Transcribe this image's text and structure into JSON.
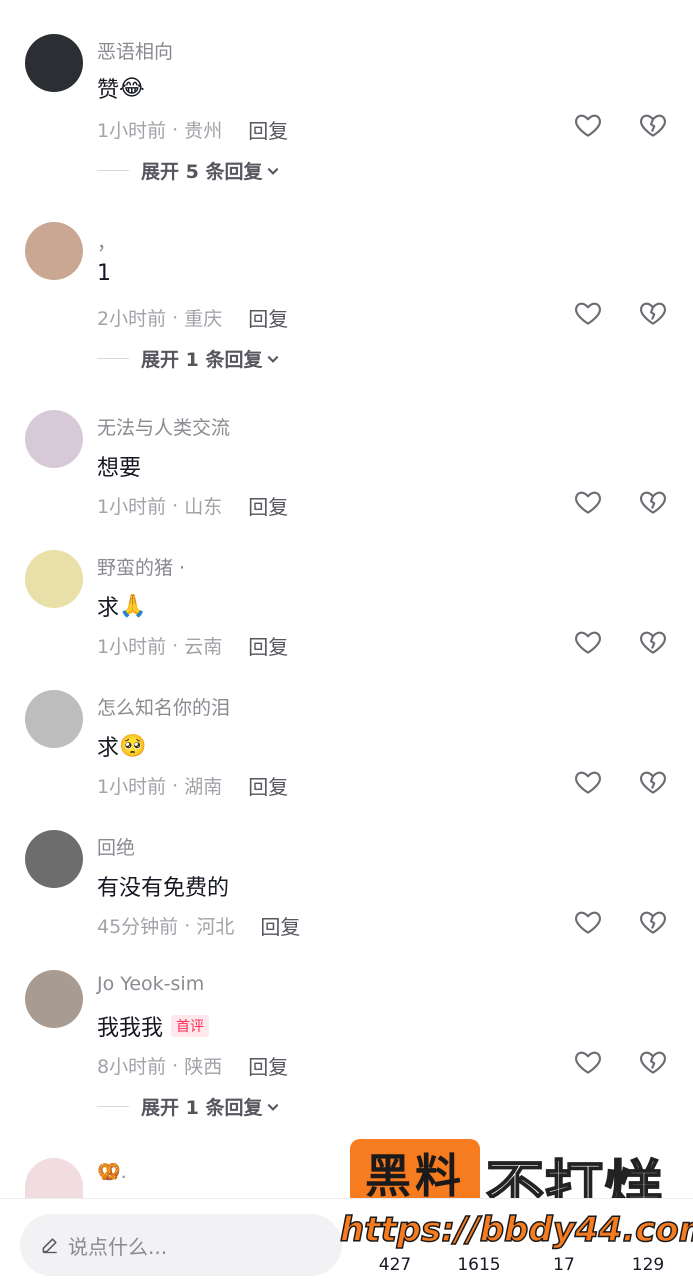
{
  "comments": [
    {
      "username": "恶语相向",
      "text": "赞",
      "emoji": "😂",
      "time": "1小时前",
      "location": "贵州",
      "reply": "回复",
      "expand": "展开 5 条回复",
      "avatar_color": "#2b2f33"
    },
    {
      "username": "，",
      "text": "1",
      "emoji": "",
      "time": "2小时前",
      "location": "重庆",
      "reply": "回复",
      "expand": "展开 1 条回复",
      "avatar_color": "#c9a792"
    },
    {
      "username": "无法与人类交流",
      "text": "想要",
      "emoji": "",
      "time": "1小时前",
      "location": "山东",
      "reply": "回复",
      "expand": "",
      "avatar_color": "#d8c9d9"
    },
    {
      "username": "野蛮的猪 ·",
      "text": "求",
      "emoji": "🙏",
      "time": "1小时前",
      "location": "云南",
      "reply": "回复",
      "expand": "",
      "avatar_color": "#e8e0a8"
    },
    {
      "username": "怎么知名你的泪",
      "text": "求",
      "emoji": "🥺",
      "time": "1小时前",
      "location": "湖南",
      "reply": "回复",
      "expand": "",
      "avatar_color": "#bdbdbd"
    },
    {
      "username": "回绝",
      "text": "有没有免费的",
      "emoji": "",
      "time": "45分钟前",
      "location": "河北",
      "reply": "回复",
      "expand": "",
      "avatar_color": "#6d6d6d"
    },
    {
      "username": "Jo Yeok-sim",
      "text": "我我我",
      "emoji": "",
      "badge": "首评",
      "time": "8小时前",
      "location": "陕西",
      "reply": "回复",
      "expand": "展开 1 条回复",
      "avatar_color": "#a89c92"
    },
    {
      "username": "🥨.",
      "text": "",
      "emoji": "",
      "time": "",
      "location": "",
      "reply": "",
      "expand": "",
      "avatar_color": "#f1dce0"
    }
  ],
  "separator": "·",
  "bottom": {
    "input_placeholder": "说点什么...",
    "counts": [
      "427",
      "1615",
      "17",
      "129"
    ]
  },
  "watermark": {
    "box_text": "黑料",
    "text": "不打烊",
    "url": "https://bbdy44.com"
  },
  "colors": {
    "accent": "#fe2c55",
    "watermark_orange": "#f77b1f"
  }
}
